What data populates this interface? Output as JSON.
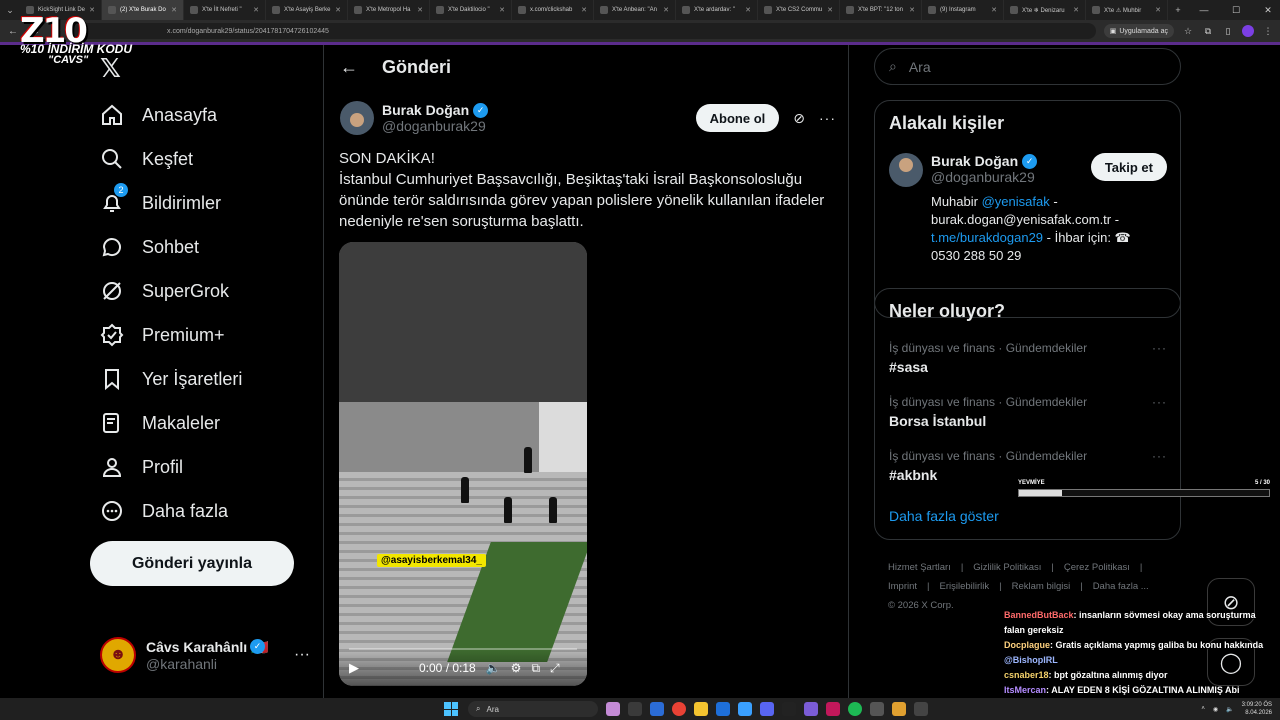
{
  "browser": {
    "tabs": [
      {
        "label": "KickSight Link De"
      },
      {
        "label": "(2) X'te Burak Do",
        "active": true
      },
      {
        "label": "X'te İlt Nefreti \""
      },
      {
        "label": "X'te Asayiş Berke"
      },
      {
        "label": "X'te Metropol Ha"
      },
      {
        "label": "X'te Daktilocio \""
      },
      {
        "label": "x.com/clickshab"
      },
      {
        "label": "X'te Anbean: \"An"
      },
      {
        "label": "X'te ardardav: \""
      },
      {
        "label": "X'te CS2 Commu"
      },
      {
        "label": "X'te BPT: \"12 ton"
      },
      {
        "label": "(9) Instagram"
      },
      {
        "label": "X'te ❄ Denizaru"
      },
      {
        "label": "X'te ⚠ Muhbir"
      }
    ],
    "url": "x.com/doganburak29/status/2041781704726102445",
    "app_pill": "Uygulamada aç"
  },
  "overlay": {
    "logo": "Z10",
    "promo": "%10 İNDİRİM KODU",
    "code": "\"CAVS\"",
    "progress_label": "YEVMİYE",
    "progress_count": "5 / 30",
    "progress_fraction": 0.17
  },
  "nav": {
    "items": [
      {
        "label": "Anasayfa",
        "icon": "home-icon"
      },
      {
        "label": "Keşfet",
        "icon": "search-icon"
      },
      {
        "label": "Bildirimler",
        "icon": "bell-icon",
        "badge": "2"
      },
      {
        "label": "Sohbet",
        "icon": "chat-icon"
      },
      {
        "label": "SuperGrok",
        "icon": "grok-icon"
      },
      {
        "label": "Premium+",
        "icon": "premium-icon"
      },
      {
        "label": "Yer İşaretleri",
        "icon": "bookmark-icon"
      },
      {
        "label": "Makaleler",
        "icon": "article-icon"
      },
      {
        "label": "Profil",
        "icon": "profile-icon"
      },
      {
        "label": "Daha fazla",
        "icon": "more-icon"
      }
    ],
    "post_button": "Gönderi yayınla",
    "me": {
      "name": "Câvs Karahânlı 🇮🇹",
      "handle": "@karahanli"
    }
  },
  "main": {
    "title": "Gönderi",
    "tweet": {
      "name": "Burak Doğan",
      "handle": "@doganburak29",
      "subscribe": "Abone ol",
      "line1": "SON DAKİKA!",
      "body": "İstanbul Cumhuriyet Başsavcılığı, Beşiktaş'taki İsrail Başkonsolosluğu önünde terör saldırısında görev yapan polislere yönelik kullanılan ifadeler nedeniyle re'sen soruşturma başlattı.",
      "media_tag": "@asayisberkemal34_",
      "video_time": "0:00 / 0:18"
    }
  },
  "right": {
    "search_placeholder": "Ara",
    "related_title": "Alakalı kişiler",
    "related": {
      "name": "Burak Doğan",
      "handle": "@doganburak29",
      "follow": "Takip et",
      "bio_prefix": "Muhabir ",
      "bio_link1": "@yenisafak",
      "bio_mid": " - burak.dogan@yenisafak.com.tr - ",
      "bio_link2": "t.me/burakdogan29",
      "bio_suffix": " - İhbar için: ☎ 0530 288 50 29"
    },
    "trends_title": "Neler oluyor?",
    "trends": [
      {
        "category": "İş dünyası ve finans · Gündemdekiler",
        "name": "#sasa"
      },
      {
        "category": "İş dünyası ve finans · Gündemdekiler",
        "name": "Borsa İstanbul"
      },
      {
        "category": "İş dünyası ve finans · Gündemdekiler",
        "name": "#akbnk"
      }
    ],
    "show_more": "Daha fazla göster",
    "footer": [
      "Hizmet Şartları",
      "|",
      "Gizlilik Politikası",
      "|",
      "Çerez Politikası",
      "|",
      "Imprint",
      "|",
      "Erişilebilirlik",
      "|",
      "Reklam bilgisi",
      "|",
      "Daha fazla ...",
      "© 2026 X Corp."
    ]
  },
  "chat": [
    {
      "user": "BannedButBack",
      "text": ": insanların sövmesi okay ama soruşturma falan gereksiz"
    },
    {
      "user": "Docplague",
      "text": ": Gratis açıklama yapmış galiba bu konu hakkında",
      "mention": "@BishopIRL"
    },
    {
      "user": "csnaber18",
      "text": ": bpt gözaltına alınmış diyor"
    },
    {
      "user": "ItsMercan",
      "text": ": ALAY EDEN 8 KİŞİ GÖZALTINA ALINMIŞ Abi",
      "mention": "@BishopIRL"
    }
  ],
  "taskbar": {
    "search": "Ara",
    "time": "3:09:20 ÖS",
    "date": "8.04.2026"
  }
}
